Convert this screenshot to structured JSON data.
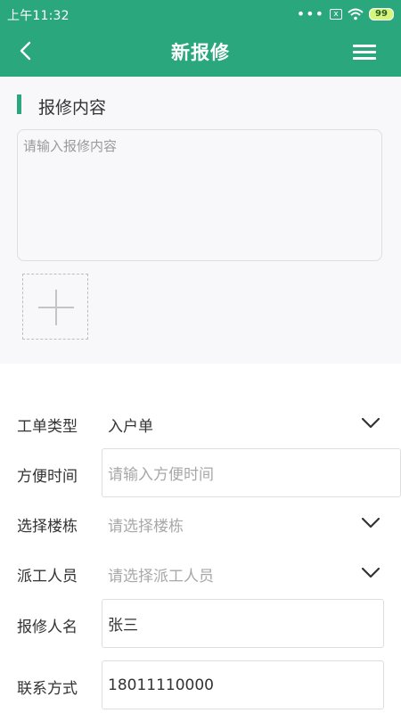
{
  "status_bar": {
    "time": "上午11:32",
    "dots": "•••",
    "sim_icon": "x",
    "battery_level": "99"
  },
  "header": {
    "title": "新报修"
  },
  "repair_content": {
    "section_title": "报修内容",
    "placeholder": "请输入报修内容"
  },
  "form": {
    "work_order_type": {
      "label": "工单类型",
      "value": "入户单"
    },
    "convenient_time": {
      "label": "方便时间",
      "placeholder": "请输入方便时间"
    },
    "building": {
      "label": "选择楼栋",
      "placeholder": "请选择楼栋"
    },
    "dispatcher": {
      "label": "派工人员",
      "placeholder": "请选择派工人员"
    },
    "reporter_name": {
      "label": "报修人名",
      "value": "张三"
    },
    "contact": {
      "label": "联系方式",
      "value": "18011110000"
    }
  },
  "colors": {
    "accent": "#2ba77e",
    "battery_fill": "#d6f57b"
  }
}
